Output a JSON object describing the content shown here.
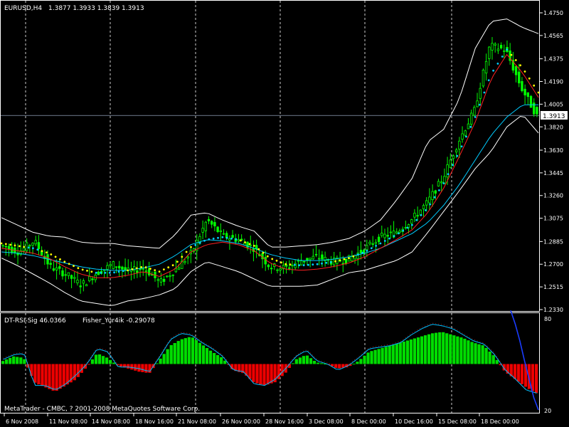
{
  "header": {
    "symbol": "EURUSD,H4",
    "ohlc": "1.3877 1.3933 1.3839 1.3913"
  },
  "indicator_header": {
    "rsi": "DT-RSI-Sig 46.0366",
    "fisher": "Fisher_Yur4ik -0.29078"
  },
  "footer": {
    "copyright": "MetaTrader - CMBC, ? 2001-2008 MetaQuotes Software Corp."
  },
  "current_price_label": "1.3913",
  "colors": {
    "background": "#000000",
    "axis": "#ffffff",
    "grid": "#ffffff",
    "candle": "#00ff00",
    "bands": "#ffffff",
    "ma_cyan": "#00ccff",
    "ma_yellow": "#ffff00",
    "ma_red": "#ff2020",
    "hist_pos": "#00dd00",
    "hist_neg": "#ee0000",
    "rsi_line": "#ff3030",
    "fisher_line": "#00bfff",
    "blue_line": "#1a3cff"
  },
  "chart_data": [
    {
      "type": "candlestick",
      "title": "EURUSD,H4",
      "ylim": [
        1.233,
        1.475
      ],
      "y_ticks": [
        "1.4750",
        "1.4565",
        "1.4375",
        "1.4190",
        "1.4005",
        "1.3820",
        "1.3630",
        "1.3445",
        "1.3260",
        "1.3075",
        "1.2885",
        "1.2700",
        "1.2515",
        "1.2330"
      ],
      "x_ticks": [
        "6 Nov 2008",
        "11 Nov 08:00",
        "14 Nov 08:00",
        "18 Nov 16:00",
        "21 Nov 08:00",
        "26 Nov 00:00",
        "28 Nov 16:00",
        "3 Dec 08:00",
        "8 Dec 00:00",
        "10 Dec 16:00",
        "15 Dec 08:00",
        "18 Dec 00:00"
      ],
      "close_path": [
        1.285,
        1.28,
        1.289,
        1.268,
        1.262,
        1.253,
        1.263,
        1.27,
        1.264,
        1.267,
        1.255,
        1.266,
        1.279,
        1.306,
        1.293,
        1.29,
        1.283,
        1.268,
        1.267,
        1.273,
        1.276,
        1.272,
        1.274,
        1.282,
        1.292,
        1.296,
        1.306,
        1.32,
        1.34,
        1.37,
        1.395,
        1.448,
        1.445,
        1.414,
        1.391
      ],
      "upper_band": [
        1.308,
        1.302,
        1.296,
        1.293,
        1.292,
        1.288,
        1.287,
        1.287,
        1.285,
        1.284,
        1.283,
        1.294,
        1.31,
        1.312,
        1.306,
        1.301,
        1.297,
        1.284,
        1.284,
        1.285,
        1.286,
        1.288,
        1.291,
        1.297,
        1.306,
        1.322,
        1.34,
        1.37,
        1.38,
        1.405,
        1.446,
        1.468,
        1.47,
        1.463,
        1.458
      ],
      "lower_band": [
        1.275,
        1.269,
        1.262,
        1.255,
        1.247,
        1.24,
        1.238,
        1.236,
        1.24,
        1.242,
        1.245,
        1.25,
        1.264,
        1.272,
        1.268,
        1.264,
        1.258,
        1.252,
        1.252,
        1.252,
        1.253,
        1.258,
        1.263,
        1.265,
        1.269,
        1.273,
        1.28,
        1.296,
        1.313,
        1.33,
        1.348,
        1.362,
        1.382,
        1.392,
        1.377
      ],
      "ma_cyan": [
        1.28,
        1.279,
        1.277,
        1.274,
        1.271,
        1.268,
        1.266,
        1.265,
        1.265,
        1.267,
        1.27,
        1.277,
        1.286,
        1.29,
        1.289,
        1.287,
        1.283,
        1.278,
        1.275,
        1.273,
        1.273,
        1.274,
        1.276,
        1.279,
        1.283,
        1.289,
        1.295,
        1.304,
        1.318,
        1.335,
        1.355,
        1.375,
        1.39,
        1.4,
        1.4
      ],
      "ma_sar_dots": [
        1.287,
        1.285,
        1.283,
        1.279,
        1.272,
        1.266,
        1.263,
        1.263,
        1.265,
        1.268,
        1.264,
        1.27,
        1.284,
        1.29,
        1.292,
        1.29,
        1.285,
        1.275,
        1.27,
        1.269,
        1.27,
        1.272,
        1.275,
        1.28,
        1.287,
        1.294,
        1.302,
        1.316,
        1.336,
        1.362,
        1.39,
        1.425,
        1.445,
        1.43,
        1.41
      ]
    },
    {
      "type": "histogram",
      "title": "DT-RSI-Sig 46.0366  Fisher_Yur4ik -0.29078",
      "ylim": [
        20,
        80
      ],
      "y_ticks": [
        "80",
        "20"
      ],
      "baseline": 50,
      "histogram": [
        52,
        55,
        54,
        38,
        35,
        32,
        36,
        40,
        48,
        57,
        54,
        49,
        47,
        45,
        44,
        53,
        62,
        66,
        68,
        63,
        58,
        54,
        46,
        44,
        38,
        36,
        38,
        44,
        53,
        56,
        51,
        50,
        47,
        48,
        52,
        58,
        60,
        62,
        64,
        66,
        68,
        70,
        71,
        69,
        67,
        64,
        62,
        55,
        45,
        40,
        35,
        31
      ],
      "rsi_line": [
        53,
        56,
        57,
        36,
        36,
        33,
        37,
        43,
        50,
        60,
        58,
        48,
        48,
        47,
        45,
        55,
        66,
        70,
        69,
        64,
        60,
        55,
        46,
        45,
        37,
        36,
        40,
        47,
        55,
        59,
        52,
        50,
        46,
        49,
        54,
        60,
        61,
        62,
        64,
        69,
        73,
        76,
        75,
        73,
        69,
        65,
        63,
        56,
        46,
        40,
        33,
        31
      ],
      "blue_line": [
        85,
        76,
        65,
        52,
        40,
        28,
        20
      ]
    }
  ]
}
